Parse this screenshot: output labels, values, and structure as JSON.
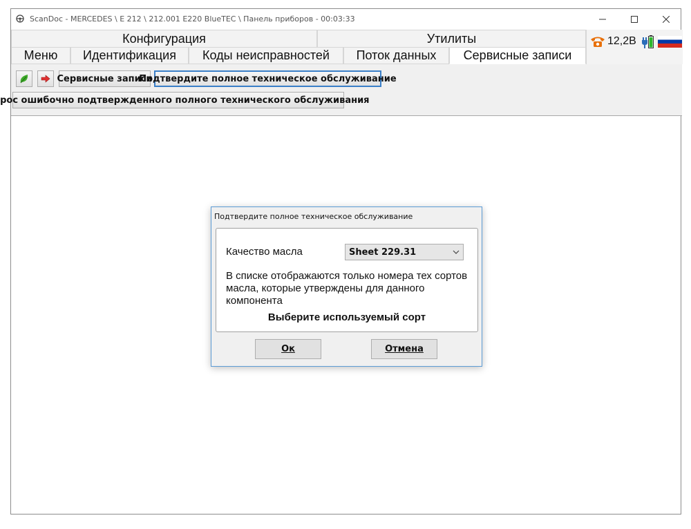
{
  "window": {
    "title": "ScanDoc - MERCEDES \\ E 212 \\ 212.001 E220 BlueTEC \\ Панель приборов - 00:03:33"
  },
  "tabs_top": [
    {
      "label": "Конфигурация"
    },
    {
      "label": "Утилиты"
    }
  ],
  "tabs_main": [
    {
      "label": "Меню"
    },
    {
      "label": "Идентификация"
    },
    {
      "label": "Коды неисправностей"
    },
    {
      "label": "Поток данных"
    },
    {
      "label": "Сервисные записи",
      "active": true
    }
  ],
  "status": {
    "voltage": "12,2В",
    "icons": [
      "phone-icon",
      "plug-icon",
      "battery-icon",
      "russia-flag-icon"
    ]
  },
  "toolbar": {
    "icons": [
      "leaf-icon",
      "exit-arrow-icon"
    ],
    "service_records": "Сервисные записи",
    "confirm_full_service": "Подтвердите полное техническое обслуживание",
    "reset_full_service": "Сброс ошибочно подтвержденного полного технического обслуживания"
  },
  "dialog": {
    "title": "Подтвердите полное техническое обслуживание",
    "oil_quality_label": "Качество масла",
    "oil_quality_value": "Sheet 229.31",
    "info": "В списке отображаются только номера тех сортов масла, которые утверждены для данного компонента",
    "choose": "Выберите используемый сорт",
    "ok": "Ок",
    "cancel": "Отмена"
  },
  "colors": {
    "accent_border": "#3a7fc8",
    "phone": "#e8700a",
    "flag": [
      "#ffffff",
      "#0039a6",
      "#d52b1e"
    ]
  }
}
